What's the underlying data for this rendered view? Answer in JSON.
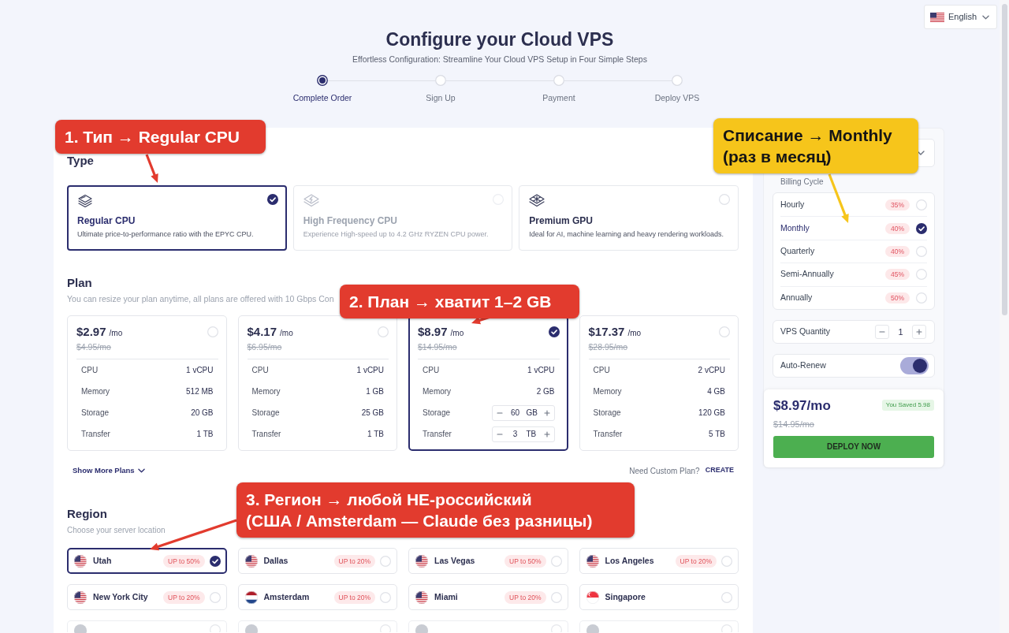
{
  "language_selector": {
    "label": "English"
  },
  "header": {
    "title": "Configure your Cloud VPS",
    "subtitle": "Effortless Configuration: Streamline Your Cloud VPS Setup in Four Simple Steps"
  },
  "steps": [
    {
      "label": "Complete Order",
      "selected": true
    },
    {
      "label": "Sign Up",
      "selected": false
    },
    {
      "label": "Payment",
      "selected": false
    },
    {
      "label": "Deploy VPS",
      "selected": false
    }
  ],
  "type_section": {
    "heading": "Type",
    "options": [
      {
        "title": "Regular CPU",
        "description": "Ultimate price-to-performance ratio with the EPYC CPU.",
        "selected": true,
        "disabled": false
      },
      {
        "title": "High Frequency CPU",
        "description": "Experience High-speed up to 4.2 GHz RYZEN CPU power.",
        "selected": false,
        "disabled": true
      },
      {
        "title": "Premium GPU",
        "description": "Ideal for AI, machine learning and heavy rendering workloads.",
        "selected": false,
        "disabled": false
      }
    ]
  },
  "plan_section": {
    "heading": "Plan",
    "subtitle": "You can resize your plan anytime, all plans are offered with 10 Gbps Con",
    "plans": [
      {
        "price": "$2.97",
        "period": "/mo",
        "old_price": "$4.95/mo",
        "selected": false,
        "specs": [
          {
            "kind": "text",
            "label": "CPU",
            "value": "1 vCPU"
          },
          {
            "kind": "text",
            "label": "Memory",
            "value": "512 MB"
          },
          {
            "kind": "text",
            "label": "Storage",
            "value": "20 GB"
          },
          {
            "kind": "text",
            "label": "Transfer",
            "value": "1 TB"
          }
        ]
      },
      {
        "price": "$4.17",
        "period": "/mo",
        "old_price": "$6.95/mo",
        "selected": false,
        "specs": [
          {
            "kind": "text",
            "label": "CPU",
            "value": "1 vCPU"
          },
          {
            "kind": "text",
            "label": "Memory",
            "value": "1 GB"
          },
          {
            "kind": "text",
            "label": "Storage",
            "value": "25 GB"
          },
          {
            "kind": "text",
            "label": "Transfer",
            "value": "1 TB"
          }
        ]
      },
      {
        "price": "$8.97",
        "period": "/mo",
        "old_price": "$14.95/mo",
        "selected": true,
        "specs": [
          {
            "kind": "text",
            "label": "CPU",
            "value": "1 vCPU"
          },
          {
            "kind": "text",
            "label": "Memory",
            "value": "2 GB"
          },
          {
            "kind": "stepper",
            "label": "Storage",
            "value": "60",
            "unit": "GB"
          },
          {
            "kind": "stepper",
            "label": "Transfer",
            "value": "3",
            "unit": "TB"
          }
        ]
      },
      {
        "price": "$17.37",
        "period": "/mo",
        "old_price": "$28.95/mo",
        "selected": false,
        "specs": [
          {
            "kind": "text",
            "label": "CPU",
            "value": "2 vCPU"
          },
          {
            "kind": "text",
            "label": "Memory",
            "value": "4 GB"
          },
          {
            "kind": "text",
            "label": "Storage",
            "value": "120 GB"
          },
          {
            "kind": "text",
            "label": "Transfer",
            "value": "5 TB"
          }
        ]
      }
    ],
    "show_more": "Show More Plans",
    "custom_prompt": "Need Custom Plan?",
    "custom_link": "CREATE"
  },
  "region_section": {
    "heading": "Region",
    "subtitle": "Choose your server location",
    "regions": [
      {
        "name": "Utah",
        "badge": "UP to 50%",
        "selected": true,
        "disabled": false
      },
      {
        "name": "Dallas",
        "badge": "UP to 20%",
        "selected": false,
        "disabled": false
      },
      {
        "name": "Las Vegas",
        "badge": "UP to 50%",
        "selected": false,
        "disabled": false
      },
      {
        "name": "Los Angeles",
        "badge": "UP to 20%",
        "selected": false,
        "disabled": false
      },
      {
        "name": "New York City",
        "badge": "UP to 20%",
        "selected": false,
        "disabled": false
      },
      {
        "name": "Amsterdam",
        "badge": "UP to 20%",
        "selected": false,
        "disabled": false
      },
      {
        "name": "Miami",
        "badge": "UP to 20%",
        "selected": false,
        "disabled": false
      },
      {
        "name": "Singapore",
        "selected": false,
        "disabled": false
      },
      {
        "disabled": true
      },
      {
        "disabled": true
      },
      {
        "disabled": true
      },
      {
        "disabled": true
      }
    ]
  },
  "sidebar": {
    "billing_label": "Billing Cycle",
    "billing_cycles": [
      {
        "label": "Hourly",
        "discount": "35%",
        "selected": false
      },
      {
        "label": "Monthly",
        "discount": "40%",
        "selected": true
      },
      {
        "label": "Quarterly",
        "discount": "40%",
        "selected": false
      },
      {
        "label": "Semi-Annually",
        "discount": "45%",
        "selected": false
      },
      {
        "label": "Annually",
        "discount": "50%",
        "selected": false
      }
    ],
    "quantity": {
      "label": "VPS Quantity",
      "value": "1"
    },
    "auto_renew": {
      "label": "Auto-Renew",
      "on": true
    },
    "summary": {
      "price": "$8.97/mo",
      "saved": "You Saved 5.98",
      "old_price": "$14.95/mo",
      "button": "DEPLOY NOW"
    }
  },
  "annotations": [
    {
      "lines": [
        "1. Тип → Regular CPU"
      ],
      "color": "#e23b2e"
    },
    {
      "lines": [
        "Списание → Monthly",
        "(раз в месяц)"
      ],
      "color": "#f6c51b"
    },
    {
      "lines": [
        "2. План → хватит 1–2 GB"
      ],
      "color": "#e23b2e"
    },
    {
      "lines": [
        "3. Регион → любой НЕ-российский",
        "(США / Amsterdam — Claude без разницы)"
      ],
      "color": "#e23b2e"
    }
  ]
}
